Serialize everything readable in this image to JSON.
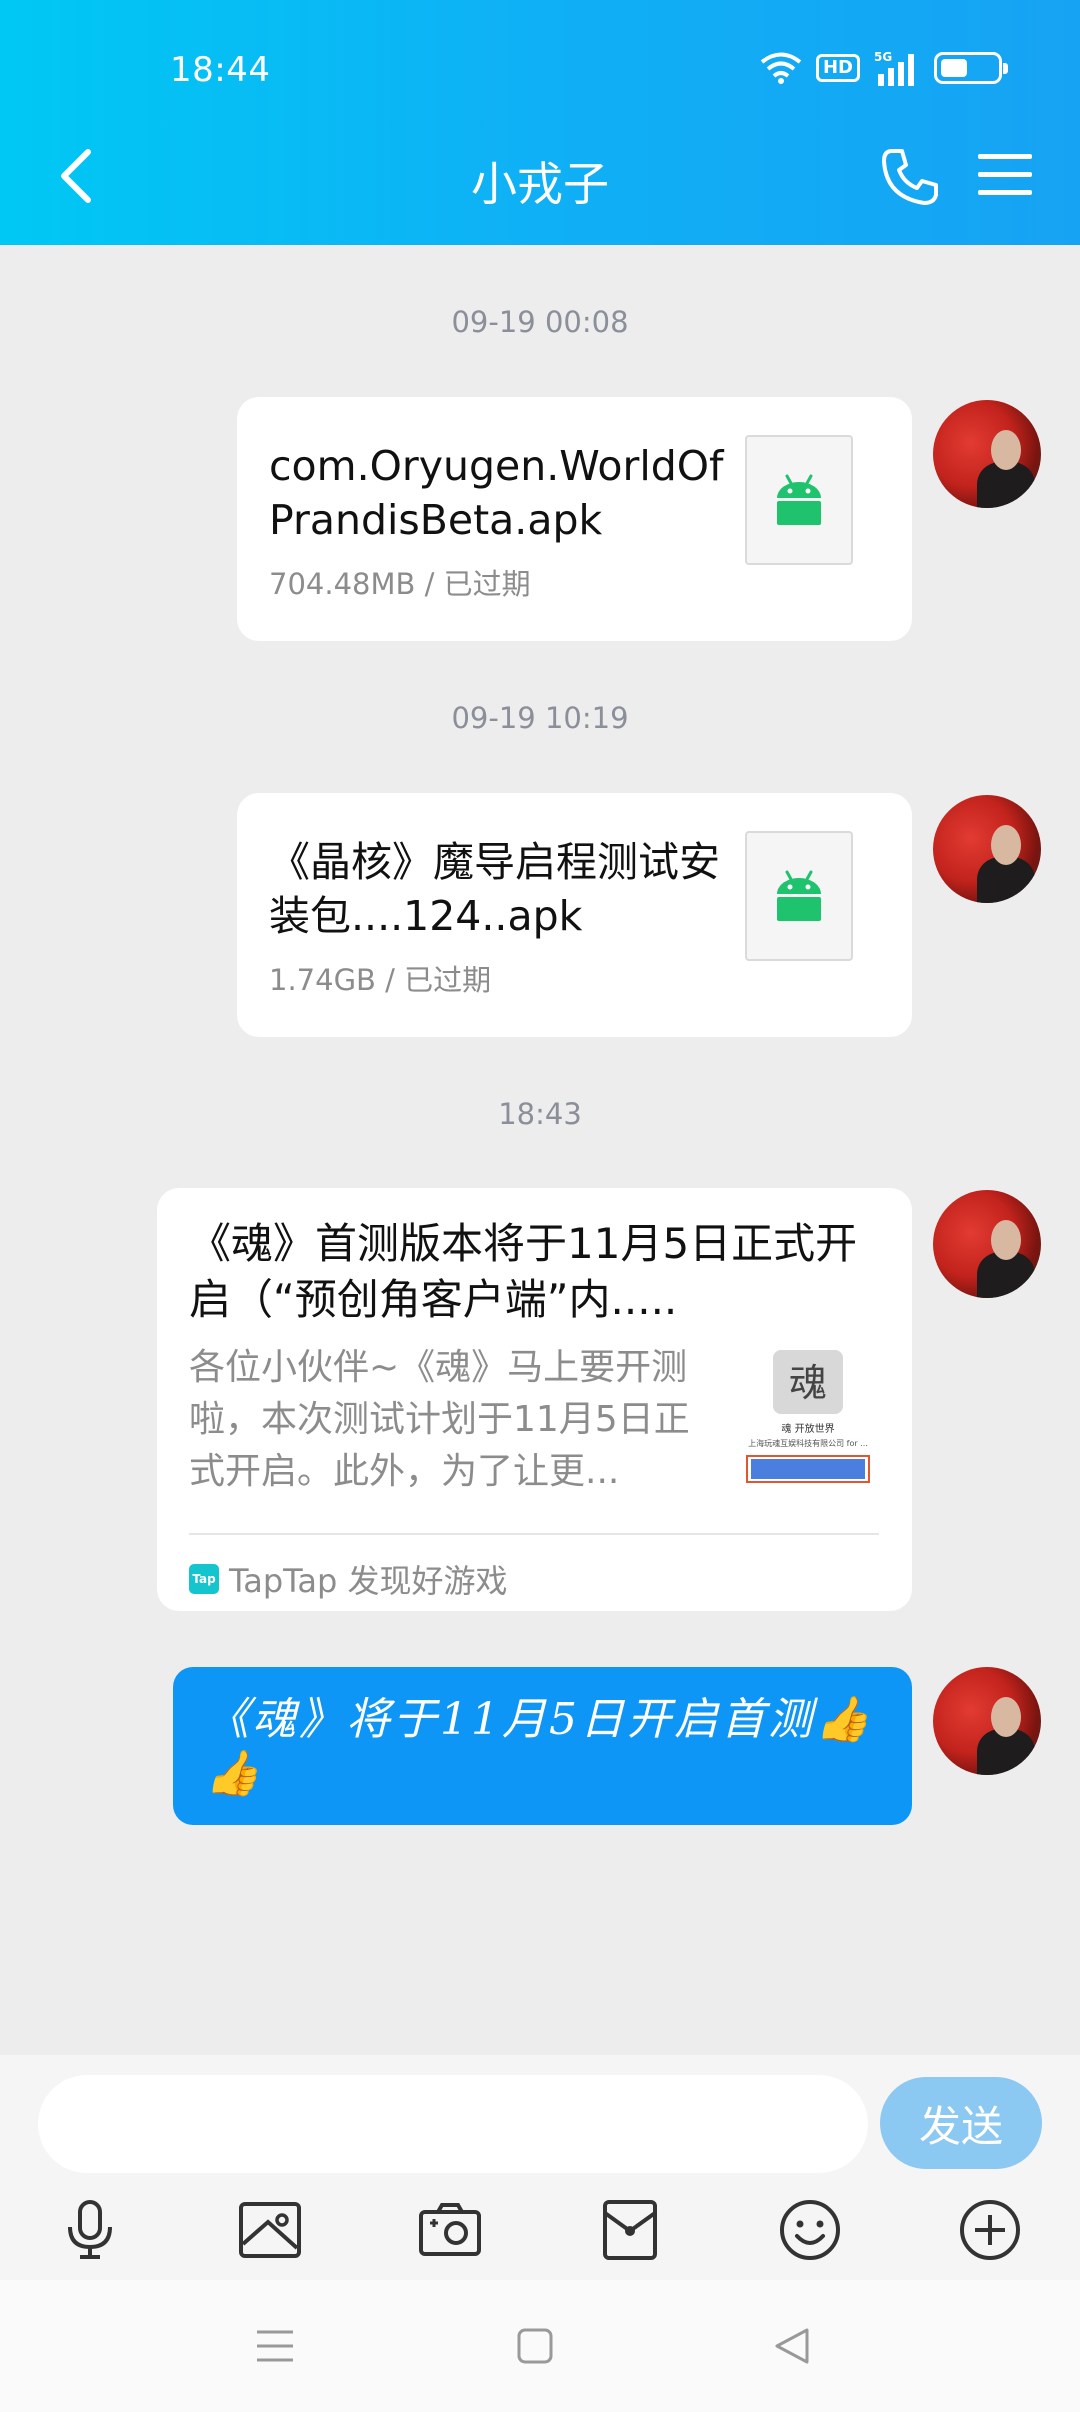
{
  "status_bar": {
    "time": "18:44",
    "hd": "HD",
    "network": "5G"
  },
  "header": {
    "title": "小戎子"
  },
  "messages": [
    {
      "timestamp": "09-19 00:08",
      "file_name": "com.Oryugen.WorldOfPrandisBeta.apk",
      "file_meta": "704.48MB / 已过期"
    },
    {
      "timestamp": "09-19 10:19",
      "file_name": "《晶核》魔导启程测试安装包....124..apk",
      "file_meta": "1.74GB / 已过期"
    },
    {
      "timestamp": "18:43",
      "card_title": "《魂》首测版本将于11月5日正式开启（“预创角客户端”内.....",
      "card_desc": "各位小伙伴~《魂》马上要开测啦，本次测试计划于11月5日正式开启。此外，为了让更...",
      "card_source": "TapTap 发现好游戏",
      "card_logo": "Tap",
      "thumb_logo": "魂",
      "thumb_caption": "魂 开放世界",
      "thumb_company": "上海玩魂互娱科技有限公司 for ..."
    },
    {
      "text": "《魂》将于11月5日开启首测👍👍"
    }
  ],
  "input": {
    "placeholder": "",
    "send_label": "发送"
  },
  "toolbar_icons": [
    "microphone-icon",
    "image-icon",
    "camera-icon",
    "red-packet-icon",
    "emoji-icon",
    "plus-icon"
  ],
  "colors": {
    "header": "#0fb0f5",
    "bubble_self": "#0e96f6",
    "send_button": "#8bc8f2",
    "android_green": "#1fc26d"
  }
}
